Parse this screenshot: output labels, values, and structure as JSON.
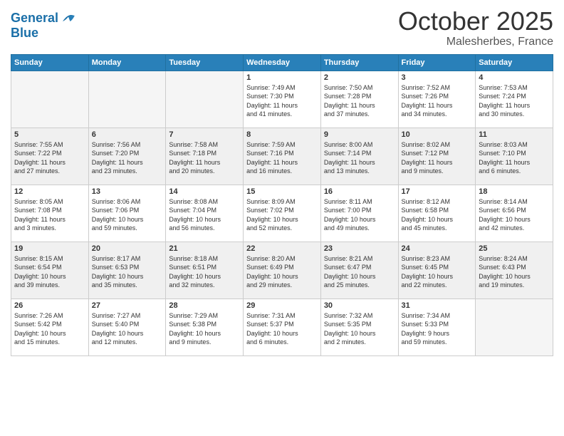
{
  "header": {
    "logo_line1": "General",
    "logo_line2": "Blue",
    "month": "October 2025",
    "location": "Malesherbes, France"
  },
  "days_of_week": [
    "Sunday",
    "Monday",
    "Tuesday",
    "Wednesday",
    "Thursday",
    "Friday",
    "Saturday"
  ],
  "weeks": [
    [
      {
        "day": "",
        "content": "",
        "empty": true
      },
      {
        "day": "",
        "content": "",
        "empty": true
      },
      {
        "day": "",
        "content": "",
        "empty": true
      },
      {
        "day": "1",
        "content": "Sunrise: 7:49 AM\nSunset: 7:30 PM\nDaylight: 11 hours\nand 41 minutes."
      },
      {
        "day": "2",
        "content": "Sunrise: 7:50 AM\nSunset: 7:28 PM\nDaylight: 11 hours\nand 37 minutes."
      },
      {
        "day": "3",
        "content": "Sunrise: 7:52 AM\nSunset: 7:26 PM\nDaylight: 11 hours\nand 34 minutes."
      },
      {
        "day": "4",
        "content": "Sunrise: 7:53 AM\nSunset: 7:24 PM\nDaylight: 11 hours\nand 30 minutes."
      }
    ],
    [
      {
        "day": "5",
        "content": "Sunrise: 7:55 AM\nSunset: 7:22 PM\nDaylight: 11 hours\nand 27 minutes.",
        "shaded": true
      },
      {
        "day": "6",
        "content": "Sunrise: 7:56 AM\nSunset: 7:20 PM\nDaylight: 11 hours\nand 23 minutes.",
        "shaded": true
      },
      {
        "day": "7",
        "content": "Sunrise: 7:58 AM\nSunset: 7:18 PM\nDaylight: 11 hours\nand 20 minutes.",
        "shaded": true
      },
      {
        "day": "8",
        "content": "Sunrise: 7:59 AM\nSunset: 7:16 PM\nDaylight: 11 hours\nand 16 minutes.",
        "shaded": true
      },
      {
        "day": "9",
        "content": "Sunrise: 8:00 AM\nSunset: 7:14 PM\nDaylight: 11 hours\nand 13 minutes.",
        "shaded": true
      },
      {
        "day": "10",
        "content": "Sunrise: 8:02 AM\nSunset: 7:12 PM\nDaylight: 11 hours\nand 9 minutes.",
        "shaded": true
      },
      {
        "day": "11",
        "content": "Sunrise: 8:03 AM\nSunset: 7:10 PM\nDaylight: 11 hours\nand 6 minutes.",
        "shaded": true
      }
    ],
    [
      {
        "day": "12",
        "content": "Sunrise: 8:05 AM\nSunset: 7:08 PM\nDaylight: 11 hours\nand 3 minutes."
      },
      {
        "day": "13",
        "content": "Sunrise: 8:06 AM\nSunset: 7:06 PM\nDaylight: 10 hours\nand 59 minutes."
      },
      {
        "day": "14",
        "content": "Sunrise: 8:08 AM\nSunset: 7:04 PM\nDaylight: 10 hours\nand 56 minutes."
      },
      {
        "day": "15",
        "content": "Sunrise: 8:09 AM\nSunset: 7:02 PM\nDaylight: 10 hours\nand 52 minutes."
      },
      {
        "day": "16",
        "content": "Sunrise: 8:11 AM\nSunset: 7:00 PM\nDaylight: 10 hours\nand 49 minutes."
      },
      {
        "day": "17",
        "content": "Sunrise: 8:12 AM\nSunset: 6:58 PM\nDaylight: 10 hours\nand 45 minutes."
      },
      {
        "day": "18",
        "content": "Sunrise: 8:14 AM\nSunset: 6:56 PM\nDaylight: 10 hours\nand 42 minutes."
      }
    ],
    [
      {
        "day": "19",
        "content": "Sunrise: 8:15 AM\nSunset: 6:54 PM\nDaylight: 10 hours\nand 39 minutes.",
        "shaded": true
      },
      {
        "day": "20",
        "content": "Sunrise: 8:17 AM\nSunset: 6:53 PM\nDaylight: 10 hours\nand 35 minutes.",
        "shaded": true
      },
      {
        "day": "21",
        "content": "Sunrise: 8:18 AM\nSunset: 6:51 PM\nDaylight: 10 hours\nand 32 minutes.",
        "shaded": true
      },
      {
        "day": "22",
        "content": "Sunrise: 8:20 AM\nSunset: 6:49 PM\nDaylight: 10 hours\nand 29 minutes.",
        "shaded": true
      },
      {
        "day": "23",
        "content": "Sunrise: 8:21 AM\nSunset: 6:47 PM\nDaylight: 10 hours\nand 25 minutes.",
        "shaded": true
      },
      {
        "day": "24",
        "content": "Sunrise: 8:23 AM\nSunset: 6:45 PM\nDaylight: 10 hours\nand 22 minutes.",
        "shaded": true
      },
      {
        "day": "25",
        "content": "Sunrise: 8:24 AM\nSunset: 6:43 PM\nDaylight: 10 hours\nand 19 minutes.",
        "shaded": true
      }
    ],
    [
      {
        "day": "26",
        "content": "Sunrise: 7:26 AM\nSunset: 5:42 PM\nDaylight: 10 hours\nand 15 minutes."
      },
      {
        "day": "27",
        "content": "Sunrise: 7:27 AM\nSunset: 5:40 PM\nDaylight: 10 hours\nand 12 minutes."
      },
      {
        "day": "28",
        "content": "Sunrise: 7:29 AM\nSunset: 5:38 PM\nDaylight: 10 hours\nand 9 minutes."
      },
      {
        "day": "29",
        "content": "Sunrise: 7:31 AM\nSunset: 5:37 PM\nDaylight: 10 hours\nand 6 minutes."
      },
      {
        "day": "30",
        "content": "Sunrise: 7:32 AM\nSunset: 5:35 PM\nDaylight: 10 hours\nand 2 minutes."
      },
      {
        "day": "31",
        "content": "Sunrise: 7:34 AM\nSunset: 5:33 PM\nDaylight: 9 hours\nand 59 minutes."
      },
      {
        "day": "",
        "content": "",
        "empty": true
      }
    ]
  ]
}
